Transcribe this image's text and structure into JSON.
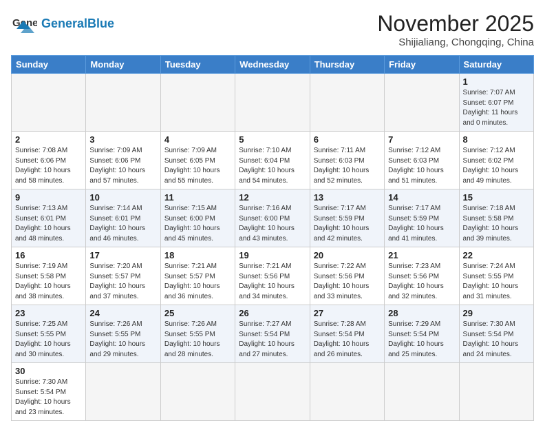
{
  "header": {
    "logo_general": "General",
    "logo_blue": "Blue",
    "month_title": "November 2025",
    "location": "Shijialiang, Chongqing, China"
  },
  "weekdays": [
    "Sunday",
    "Monday",
    "Tuesday",
    "Wednesday",
    "Thursday",
    "Friday",
    "Saturday"
  ],
  "weeks": [
    [
      {
        "day": "",
        "info": ""
      },
      {
        "day": "",
        "info": ""
      },
      {
        "day": "",
        "info": ""
      },
      {
        "day": "",
        "info": ""
      },
      {
        "day": "",
        "info": ""
      },
      {
        "day": "",
        "info": ""
      },
      {
        "day": "1",
        "info": "Sunrise: 7:07 AM\nSunset: 6:07 PM\nDaylight: 11 hours and 0 minutes."
      }
    ],
    [
      {
        "day": "2",
        "info": "Sunrise: 7:08 AM\nSunset: 6:06 PM\nDaylight: 10 hours and 58 minutes."
      },
      {
        "day": "3",
        "info": "Sunrise: 7:09 AM\nSunset: 6:06 PM\nDaylight: 10 hours and 57 minutes."
      },
      {
        "day": "4",
        "info": "Sunrise: 7:09 AM\nSunset: 6:05 PM\nDaylight: 10 hours and 55 minutes."
      },
      {
        "day": "5",
        "info": "Sunrise: 7:10 AM\nSunset: 6:04 PM\nDaylight: 10 hours and 54 minutes."
      },
      {
        "day": "6",
        "info": "Sunrise: 7:11 AM\nSunset: 6:03 PM\nDaylight: 10 hours and 52 minutes."
      },
      {
        "day": "7",
        "info": "Sunrise: 7:12 AM\nSunset: 6:03 PM\nDaylight: 10 hours and 51 minutes."
      },
      {
        "day": "8",
        "info": "Sunrise: 7:12 AM\nSunset: 6:02 PM\nDaylight: 10 hours and 49 minutes."
      }
    ],
    [
      {
        "day": "9",
        "info": "Sunrise: 7:13 AM\nSunset: 6:01 PM\nDaylight: 10 hours and 48 minutes."
      },
      {
        "day": "10",
        "info": "Sunrise: 7:14 AM\nSunset: 6:01 PM\nDaylight: 10 hours and 46 minutes."
      },
      {
        "day": "11",
        "info": "Sunrise: 7:15 AM\nSunset: 6:00 PM\nDaylight: 10 hours and 45 minutes."
      },
      {
        "day": "12",
        "info": "Sunrise: 7:16 AM\nSunset: 6:00 PM\nDaylight: 10 hours and 43 minutes."
      },
      {
        "day": "13",
        "info": "Sunrise: 7:17 AM\nSunset: 5:59 PM\nDaylight: 10 hours and 42 minutes."
      },
      {
        "day": "14",
        "info": "Sunrise: 7:17 AM\nSunset: 5:59 PM\nDaylight: 10 hours and 41 minutes."
      },
      {
        "day": "15",
        "info": "Sunrise: 7:18 AM\nSunset: 5:58 PM\nDaylight: 10 hours and 39 minutes."
      }
    ],
    [
      {
        "day": "16",
        "info": "Sunrise: 7:19 AM\nSunset: 5:58 PM\nDaylight: 10 hours and 38 minutes."
      },
      {
        "day": "17",
        "info": "Sunrise: 7:20 AM\nSunset: 5:57 PM\nDaylight: 10 hours and 37 minutes."
      },
      {
        "day": "18",
        "info": "Sunrise: 7:21 AM\nSunset: 5:57 PM\nDaylight: 10 hours and 36 minutes."
      },
      {
        "day": "19",
        "info": "Sunrise: 7:21 AM\nSunset: 5:56 PM\nDaylight: 10 hours and 34 minutes."
      },
      {
        "day": "20",
        "info": "Sunrise: 7:22 AM\nSunset: 5:56 PM\nDaylight: 10 hours and 33 minutes."
      },
      {
        "day": "21",
        "info": "Sunrise: 7:23 AM\nSunset: 5:56 PM\nDaylight: 10 hours and 32 minutes."
      },
      {
        "day": "22",
        "info": "Sunrise: 7:24 AM\nSunset: 5:55 PM\nDaylight: 10 hours and 31 minutes."
      }
    ],
    [
      {
        "day": "23",
        "info": "Sunrise: 7:25 AM\nSunset: 5:55 PM\nDaylight: 10 hours and 30 minutes."
      },
      {
        "day": "24",
        "info": "Sunrise: 7:26 AM\nSunset: 5:55 PM\nDaylight: 10 hours and 29 minutes."
      },
      {
        "day": "25",
        "info": "Sunrise: 7:26 AM\nSunset: 5:55 PM\nDaylight: 10 hours and 28 minutes."
      },
      {
        "day": "26",
        "info": "Sunrise: 7:27 AM\nSunset: 5:54 PM\nDaylight: 10 hours and 27 minutes."
      },
      {
        "day": "27",
        "info": "Sunrise: 7:28 AM\nSunset: 5:54 PM\nDaylight: 10 hours and 26 minutes."
      },
      {
        "day": "28",
        "info": "Sunrise: 7:29 AM\nSunset: 5:54 PM\nDaylight: 10 hours and 25 minutes."
      },
      {
        "day": "29",
        "info": "Sunrise: 7:30 AM\nSunset: 5:54 PM\nDaylight: 10 hours and 24 minutes."
      }
    ],
    [
      {
        "day": "30",
        "info": "Sunrise: 7:30 AM\nSunset: 5:54 PM\nDaylight: 10 hours and 23 minutes."
      },
      {
        "day": "",
        "info": ""
      },
      {
        "day": "",
        "info": ""
      },
      {
        "day": "",
        "info": ""
      },
      {
        "day": "",
        "info": ""
      },
      {
        "day": "",
        "info": ""
      },
      {
        "day": "",
        "info": ""
      }
    ]
  ]
}
